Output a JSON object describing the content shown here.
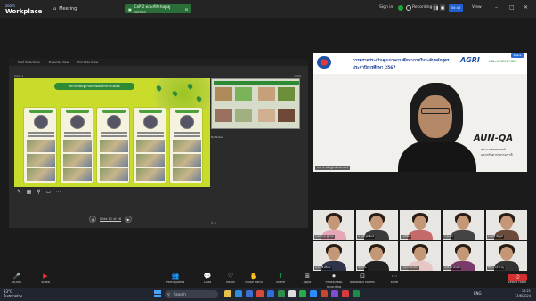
{
  "titlebar": {
    "brand_top": "zoom",
    "brand_bottom": "Workplace",
    "meeting_tab": "Meeting",
    "share_pill": "CoP 2 คณะที่กำลังดูอยู่ screen",
    "sign_in": "Sign in",
    "recording": "Recording...",
    "timer": "00:48",
    "view": "View"
  },
  "share": {
    "toolbar": [
      "Start Slide Show",
      "Presenter View",
      "End Slide Show"
    ],
    "slide_counter": "Slide 1",
    "zoom_label": "100%",
    "slide_header": "สถานีเรียนรู้ด้านการผลิตไก่ชาตะคณล",
    "pager": "Slide 11 of 16",
    "notes": "No Notes",
    "next_slide_title": "ผลการดำเนินงาน"
  },
  "speaker": {
    "banner_line1": "การตรวจประเมินคุณภาพการศึกษาภายในระดับหลักสูตร",
    "banner_line2": "ประจำปีการศึกษา 2567",
    "agri": "AGRI",
    "agri_sub": "คณะเกษตรศาสตร์",
    "blue_btn": "Share",
    "aun": "AUN-QA",
    "aun_sub1": "คณะเกษตรศาสตร์",
    "aun_sub2": "และทรัพยากรธรรมชาติ",
    "name_tag": "CoP 2 หลักสูตรสัตวศาสตร์"
  },
  "gallery": [
    {
      "name": "อ.สมพร พ. ผู้ตรวจ",
      "shirt": "#e7a6b6"
    },
    {
      "name": "อ.วันดี อุดอินทร์",
      "shirt": "#3a3a3a"
    },
    {
      "name": "อ.พรพิมล",
      "shirt": "#c46a6a"
    },
    {
      "name": "อ.รุ่งนภา",
      "shirt": "#444"
    },
    {
      "name": "อ.สมศรี เพ็ญคำ",
      "shirt": "#6a4a3a"
    },
    {
      "name": "อ.ปราณี ศรีทอง",
      "shirt": "#30344a"
    },
    {
      "name": "Nutcha",
      "shirt": "#222"
    },
    {
      "name": "อ.ชยาภรณ์ Porn",
      "shirt": "#e7c6c6"
    },
    {
      "name": "CoP สัตวศาสตร์",
      "shirt": "#7a3b6b"
    },
    {
      "name": "วิจิตรา แก้วกาญ",
      "shirt": "#333"
    }
  ],
  "controls": [
    {
      "label": "Audio",
      "icon": "microphone-icon"
    },
    {
      "label": "Video",
      "icon": "camera-icon"
    },
    {
      "label": "Participants",
      "icon": "participants-icon"
    },
    {
      "label": "Chat",
      "icon": "chat-icon"
    },
    {
      "label": "React",
      "icon": "heart-icon"
    },
    {
      "label": "Raise hand",
      "icon": "hand-icon"
    },
    {
      "label": "Share",
      "icon": "share-icon"
    },
    {
      "label": "Apps",
      "icon": "apps-icon"
    },
    {
      "label": "Pause/stop recording",
      "icon": "record-icon"
    },
    {
      "label": "Breakout rooms",
      "icon": "breakout-icon"
    },
    {
      "label": "More",
      "icon": "more-icon"
    }
  ],
  "leave": "Leave room",
  "taskbar": {
    "weather_temp": "33°C",
    "weather_desc": "มีเมฆบางส่วน",
    "search": "Search",
    "tray": "ENG",
    "time": "10:21",
    "date": "13/8/2024"
  }
}
